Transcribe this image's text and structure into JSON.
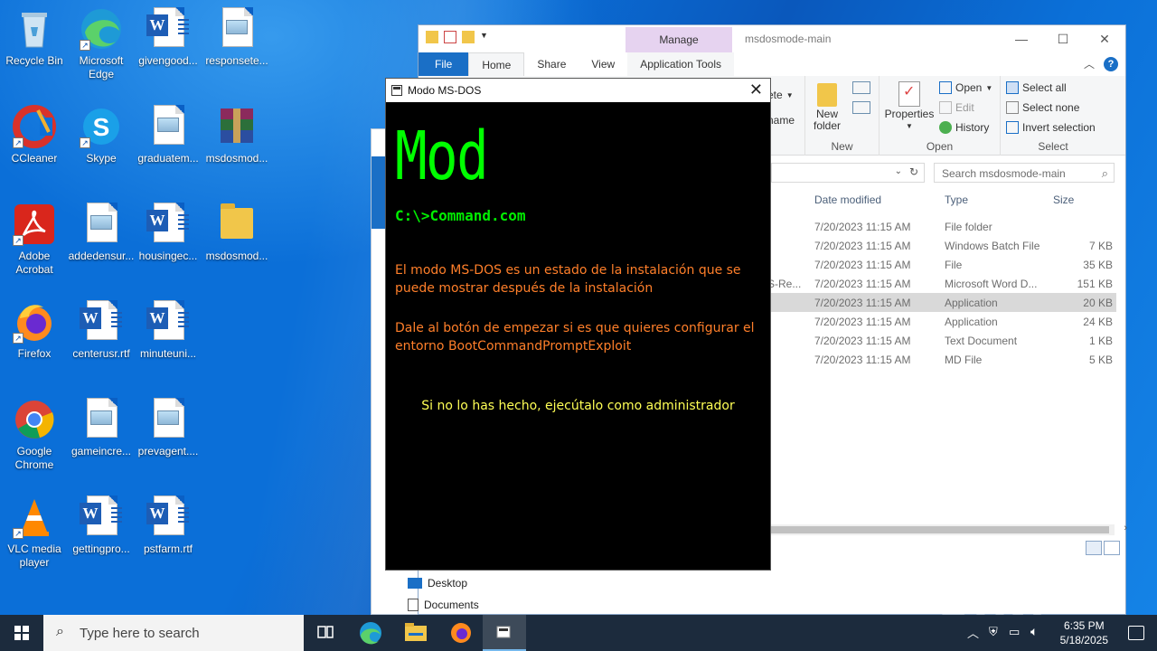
{
  "desktop": {
    "icons": [
      {
        "label": "Recycle Bin"
      },
      {
        "label": "Microsoft Edge"
      },
      {
        "label": "givengood..."
      },
      {
        "label": "responsete..."
      },
      {
        "label": "CCleaner"
      },
      {
        "label": "Skype"
      },
      {
        "label": "graduatem..."
      },
      {
        "label": "msdosmod..."
      },
      {
        "label": "Adobe Acrobat"
      },
      {
        "label": "addedensur..."
      },
      {
        "label": "housingec..."
      },
      {
        "label": "msdosmod..."
      },
      {
        "label": "Firefox"
      },
      {
        "label": "centerusr.rtf"
      },
      {
        "label": "minuteuni..."
      },
      {
        "label": "Google Chrome"
      },
      {
        "label": "gameincre..."
      },
      {
        "label": "prevagent...."
      },
      {
        "label": "VLC media player"
      },
      {
        "label": "gettingpro..."
      },
      {
        "label": "pstfarm.rtf"
      }
    ]
  },
  "explorer": {
    "title": "msdosmode-main",
    "manage_tab": "Manage",
    "tabs": {
      "file": "File",
      "home": "Home",
      "share": "Share",
      "view": "View",
      "app_tools": "Application Tools"
    },
    "ribbon": {
      "partial_delete": "ete",
      "partial_rename": "name",
      "new_folder": "New folder",
      "group_new": "New",
      "properties": "Properties",
      "open": "Open",
      "edit": "Edit",
      "history": "History",
      "group_open": "Open",
      "select_all": "Select all",
      "select_none": "Select none",
      "invert_selection": "Invert selection",
      "group_select": "Select"
    },
    "search_placeholder": "Search msdosmode-main",
    "columns": {
      "date": "Date modified",
      "type": "Type",
      "size": "Size"
    },
    "rows": [
      {
        "name": "",
        "date": "7/20/2023 11:15 AM",
        "type": "File folder",
        "size": ""
      },
      {
        "name": "",
        "date": "7/20/2023 11:15 AM",
        "type": "Windows Batch File",
        "size": "7 KB"
      },
      {
        "name": "",
        "date": "7/20/2023 11:15 AM",
        "type": "File",
        "size": "35 KB"
      },
      {
        "name": "S-Re...",
        "date": "7/20/2023 11:15 AM",
        "type": "Microsoft Word D...",
        "size": "151 KB"
      },
      {
        "name": "",
        "date": "7/20/2023 11:15 AM",
        "type": "Application",
        "size": "20 KB"
      },
      {
        "name": "",
        "date": "7/20/2023 11:15 AM",
        "type": "Application",
        "size": "24 KB"
      },
      {
        "name": "",
        "date": "7/20/2023 11:15 AM",
        "type": "Text Document",
        "size": "1 KB"
      },
      {
        "name": "",
        "date": "7/20/2023 11:15 AM",
        "type": "MD File",
        "size": "5 KB"
      }
    ],
    "nav": {
      "desktop": "Desktop",
      "documents": "Documents"
    }
  },
  "dos_window": {
    "title": "Modo MS-DOS",
    "big_text": "Mod",
    "command": "C:\\>Command.com",
    "para1": "El modo MS-DOS es un estado de la instalación que se puede mostrar después de la instalación",
    "para2": "Dale al botón de empezar si es que quieres configurar el entorno BootCommandPromptExploit",
    "admin_note": "Si no lo has hecho, ejecútalo como administrador"
  },
  "watermark": "ANY RUN",
  "taskbar": {
    "search_placeholder": "Type here to search",
    "time": "6:35 PM",
    "date": "5/18/2025"
  }
}
